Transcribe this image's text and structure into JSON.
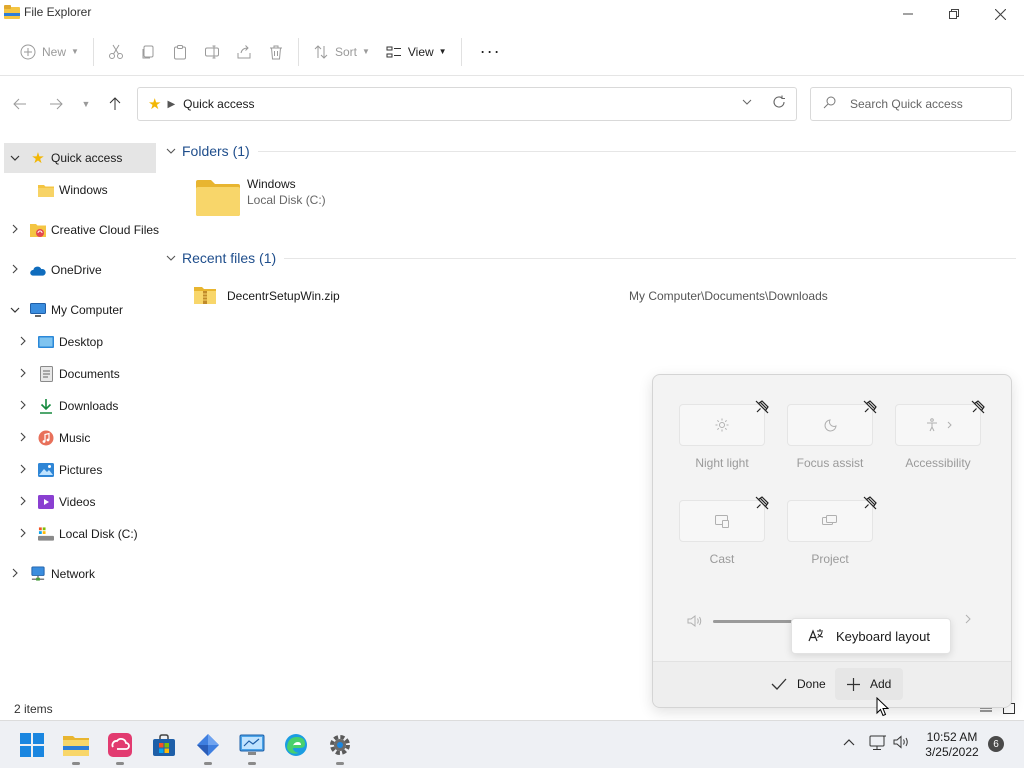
{
  "window": {
    "title": "File Explorer"
  },
  "toolbar": {
    "new_label": "New",
    "sort_label": "Sort",
    "view_label": "View",
    "more_label": "···"
  },
  "address": {
    "crumb": "Quick access"
  },
  "search": {
    "placeholder": "Search Quick access"
  },
  "sidebar": {
    "items": [
      {
        "label": "Quick access"
      },
      {
        "label": "Windows"
      },
      {
        "label": "Creative Cloud Files"
      },
      {
        "label": "OneDrive"
      },
      {
        "label": "My Computer"
      },
      {
        "label": "Desktop"
      },
      {
        "label": "Documents"
      },
      {
        "label": "Downloads"
      },
      {
        "label": "Music"
      },
      {
        "label": "Pictures"
      },
      {
        "label": "Videos"
      },
      {
        "label": "Local Disk (C:)"
      },
      {
        "label": "Network"
      }
    ]
  },
  "content": {
    "folders_header": "Folders (1)",
    "folder": {
      "name": "Windows",
      "location": "Local Disk (C:)"
    },
    "recent_header": "Recent files (1)",
    "recent": {
      "name": "DecentrSetupWin.zip",
      "path": "My Computer\\Documents\\Downloads"
    }
  },
  "status": {
    "items": "2 items"
  },
  "quick_settings": {
    "tiles": [
      {
        "label": "Night light"
      },
      {
        "label": "Focus assist"
      },
      {
        "label": "Accessibility"
      },
      {
        "label": "Cast"
      },
      {
        "label": "Project"
      }
    ],
    "volume_fraction": 0.38,
    "keyboard_layout_label": "Keyboard layout",
    "done_label": "Done",
    "add_label": "Add"
  },
  "taskbar": {
    "time": "10:52 AM",
    "date": "3/25/2022",
    "notifications": "6"
  },
  "colors": {
    "accent": "#0067c0",
    "folder": "#f4c542",
    "selected": "#e5e5e5"
  }
}
